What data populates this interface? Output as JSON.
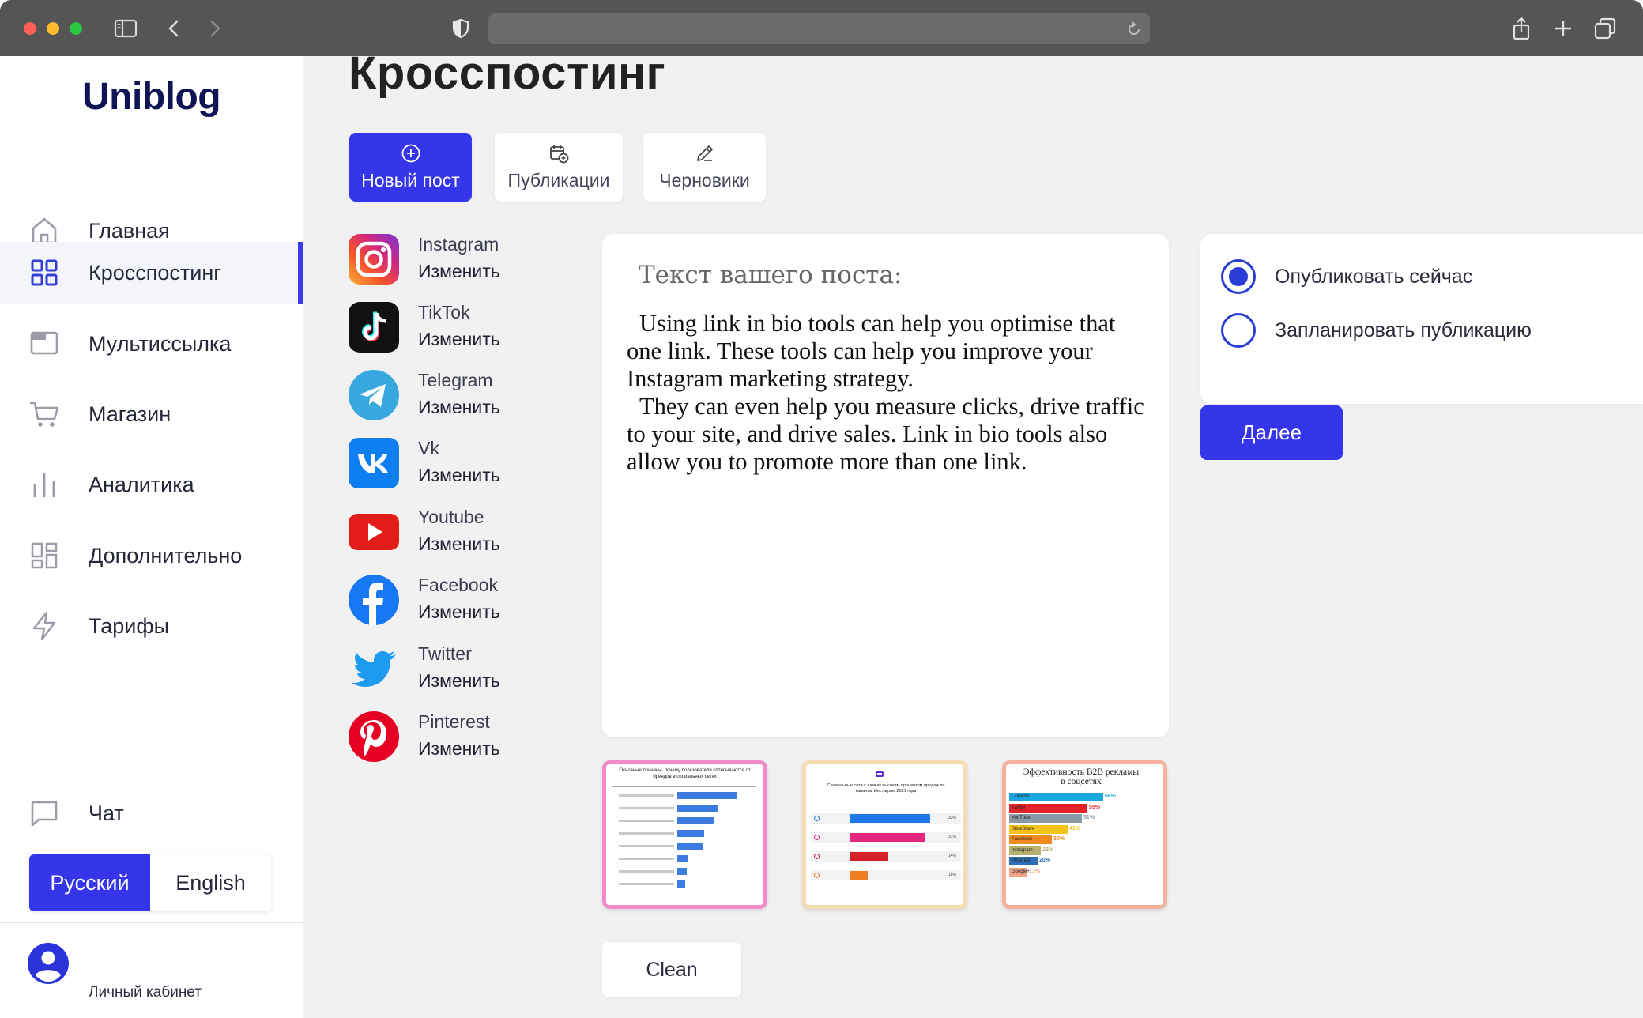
{
  "app": {
    "logo": "Uniblog"
  },
  "sidebar": {
    "items": [
      {
        "label": "Главная",
        "icon": "home-icon"
      },
      {
        "label": "Кросспостинг",
        "icon": "grid-icon",
        "active": true
      },
      {
        "label": "Мультиссылка",
        "icon": "browser-window-icon"
      },
      {
        "label": "Магазин",
        "icon": "cart-icon"
      },
      {
        "label": "Аналитика",
        "icon": "bar-chart-icon"
      },
      {
        "label": "Дополнительно",
        "icon": "dashboard-icon"
      },
      {
        "label": "Тарифы",
        "icon": "lightning-icon"
      }
    ],
    "chat": "Чат",
    "languages": {
      "ru": "Русский",
      "en": "English",
      "selected": "ru"
    },
    "cabinet": "Личный кабинет"
  },
  "main": {
    "title": "Кросспостинг",
    "tabs": [
      {
        "label": "Новый пост",
        "icon": "plus-circle-icon",
        "active": true
      },
      {
        "label": "Публикации",
        "icon": "calendar-add-icon"
      },
      {
        "label": "Черновики",
        "icon": "pencil-icon"
      }
    ],
    "networks": [
      {
        "name": "Instagram",
        "action": "Изменить"
      },
      {
        "name": "TikTok",
        "action": "Изменить"
      },
      {
        "name": "Telegram",
        "action": "Изменить"
      },
      {
        "name": "Vk",
        "action": "Изменить"
      },
      {
        "name": "Youtube",
        "action": "Изменить"
      },
      {
        "name": "Facebook",
        "action": "Изменить"
      },
      {
        "name": "Twitter",
        "action": "Изменить"
      },
      {
        "name": "Pinterest",
        "action": "Изменить"
      }
    ],
    "editor": {
      "label": "Текст вашего поста:",
      "paragraphs": [
        "Using link in bio tools can help you optimise that one link. These tools can help you improve your Instagram marketing strategy.",
        "They can even help you measure clicks, drive traffic to your site, and drive sales. Link in bio tools also allow you to promote more than one link."
      ]
    },
    "thumbnails": [
      {
        "title": "Основные причины, почему пользователи отписываются от брендов в социальных сетях",
        "values": [
          0.8,
          0.55,
          0.48,
          0.36,
          0.35,
          0.15,
          0.13,
          0.1
        ]
      },
      {
        "title": "Социальные сети с самым высоким процентом продаж по каналам Инстаграм 2021 года",
        "values": [
          0.84,
          0.79,
          0.4,
          0.18
        ],
        "percents": [
          "33%",
          "31%",
          "14%",
          "18%"
        ]
      },
      {
        "title": "Эффективность B2B рекламы в соцсетях",
        "rows": [
          {
            "name": "LinkedIn",
            "value": "66%"
          },
          {
            "name": "Twitter",
            "value": "55%"
          },
          {
            "name": "YouTube",
            "value": "51%"
          },
          {
            "name": "SlideShare",
            "value": "41%"
          },
          {
            "name": "Facebook",
            "value": "30%"
          },
          {
            "name": "Instagram",
            "value": "22%"
          },
          {
            "name": "Pinterest",
            "value": "20%"
          },
          {
            "name": "Google+",
            "value": "13%"
          }
        ]
      }
    ],
    "clean": "Clean",
    "publish": {
      "options": [
        {
          "label": "Опубликовать сейчас",
          "selected": true
        },
        {
          "label": "Запланировать публикацию",
          "selected": false
        }
      ],
      "next": "Далее"
    }
  },
  "colors": {
    "accent": "#3535ea",
    "logo": "#0f1456"
  }
}
